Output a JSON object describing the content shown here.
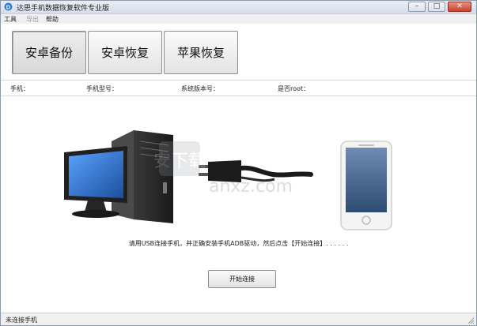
{
  "window": {
    "title": "达思手机数据恢复软件专业版",
    "controls": {
      "minimize": "–",
      "maximize": "□",
      "close": "✕"
    }
  },
  "menu": {
    "items": [
      {
        "label": "工具",
        "enabled": true
      },
      {
        "label": "导出",
        "enabled": false
      },
      {
        "label": "帮助",
        "enabled": true
      }
    ]
  },
  "mode_buttons": [
    {
      "label": "安卓备份",
      "selected": true
    },
    {
      "label": "安卓恢复",
      "selected": false
    },
    {
      "label": "苹果恢复",
      "selected": false
    }
  ],
  "device_info": {
    "phone_label": "手机：",
    "model_label": "手机型号：",
    "os_version_label": "系统版本号：",
    "root_label": "是否root："
  },
  "illustration": {
    "computer_icon": "desktop-computer-icon",
    "cable_icon": "usb-cable-icon",
    "phone_icon": "smartphone-icon",
    "watermark_text": "安下载",
    "watermark_url": "anxz.com"
  },
  "instruction": "请用USB连接手机，并正确安装手机ADB驱动，然后点击【开始连接】. . . . . .",
  "connect_button": "开始连接",
  "status": "未连接手机",
  "colors": {
    "titlebar": "#dde4ee",
    "close_button": "#c9412c",
    "monitor_screen": "#2a6fcf",
    "tower": "#2b2b2b",
    "phone_screen": "#3f5f86"
  }
}
